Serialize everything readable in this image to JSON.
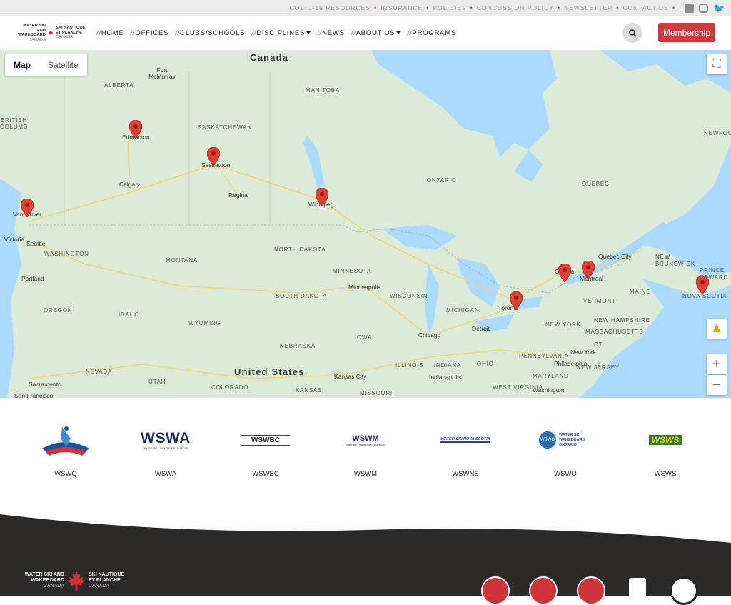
{
  "topbar": {
    "links": [
      "COVID-19 RESOURCES",
      "INSURANCE",
      "POLICIES",
      "CONCUSSION POLICY",
      "NEWSLETTER",
      "CONTACT US"
    ],
    "social_icons": [
      "facebook-icon",
      "instagram-icon",
      "twitter-icon"
    ]
  },
  "logo": {
    "left_text": "WATER SKI AND WAKEBOARD",
    "left_sub": "CANADA",
    "right_text": "SKI NAUTIQUE ET PLANCHE",
    "right_sub": "CANADA"
  },
  "nav": {
    "prefix": "//",
    "items": [
      "HOME",
      "OFFICES",
      "CLUBS/SCHOOLS",
      "DISCIPLINES",
      "NEWS",
      "ABOUT US",
      "PROGRAMS"
    ]
  },
  "header": {
    "search_icon": "search-icon",
    "membership_label": "Membership"
  },
  "map": {
    "type_options": [
      "Map",
      "Satellite"
    ],
    "selected_type": "Map",
    "countries": [
      "Canada",
      "United States"
    ],
    "regions": [
      "ALBERTA",
      "MANITOBA",
      "SASKATCHEWAN",
      "ONTARIO",
      "QUEBEC",
      "BRITISH COLUMBIA",
      "NORTH DAKOTA",
      "MONTANA",
      "MINNESOTA",
      "SOUTH DAKOTA",
      "WASHINGTON",
      "OREGON",
      "IDAHO",
      "WYOMING",
      "NEBRASKA",
      "IOWA",
      "WISCONSIN",
      "MICHIGAN",
      "ILLINOIS",
      "INDIANA",
      "OHIO",
      "UTAH",
      "NEVADA",
      "COLORADO",
      "KANSAS",
      "MISSOURI",
      "PENNSYLVANIA",
      "NEW YORK",
      "MAINE",
      "VERMONT",
      "NEW HAMPSHIRE",
      "MASSACHUSETTS",
      "NEW BRUNSWICK",
      "NOVA SCOTIA",
      "PRINCE EDWARD ISLAND",
      "NEWFOUNDLAND",
      "WEST VIRGINIA",
      "MARYLAND",
      "NEW JERSEY",
      "CT"
    ],
    "cities": [
      "Fort McMurray",
      "Edmonton",
      "Calgary",
      "Saskatoon",
      "Regina",
      "Winnipeg",
      "Vancouver",
      "Victoria",
      "Seattle",
      "Portland",
      "Minneapolis",
      "Toronto",
      "Ottawa",
      "Montreal",
      "Quebec City",
      "Chicago",
      "Detroit",
      "Indianapolis",
      "Kansas City",
      "Sacramento",
      "San Francisco",
      "Philadelphia",
      "New York",
      "Washington"
    ],
    "markers": [
      "Edmonton",
      "Saskatoon",
      "Winnipeg",
      "Vancouver",
      "Toronto",
      "Ottawa",
      "Montreal",
      "Nova Scotia"
    ],
    "controls": [
      "fullscreen-icon",
      "pegman-icon",
      "zoom-in-icon",
      "zoom-out-icon"
    ],
    "zoom_in": "+",
    "zoom_out": "−"
  },
  "associations": [
    {
      "name": "WSWQ"
    },
    {
      "name": "WSWA",
      "logo_text": "WSWA",
      "logo_sub": "WATER SKI & WAKEBOARD ALBERTA"
    },
    {
      "name": "WSWBC",
      "logo_text": "WSWBC"
    },
    {
      "name": "WSWM",
      "logo_text": "WSWM",
      "logo_sub": "water ski · wakeboard manitoba"
    },
    {
      "name": "WSWNS",
      "logo_text": "WATER SKI NOVA SCOTIA"
    },
    {
      "name": "WSWO",
      "logo_text": "WATER SKI WAKEBOARD ONTARIO",
      "logo_mark": "WSWO"
    },
    {
      "name": "WSWS",
      "logo_text": "WSWS"
    }
  ],
  "footer": {
    "left_text": "WATER SKI AND WAKEBOARD",
    "left_sub": "CANADA",
    "right_text": "SKI NAUTIQUE ET PLANCHE",
    "right_sub": "CANADA"
  },
  "colors": {
    "accent": "#cf3a3d",
    "water": "#aadaff",
    "land": "#dcebd7",
    "footer": "#2d2a2a"
  }
}
